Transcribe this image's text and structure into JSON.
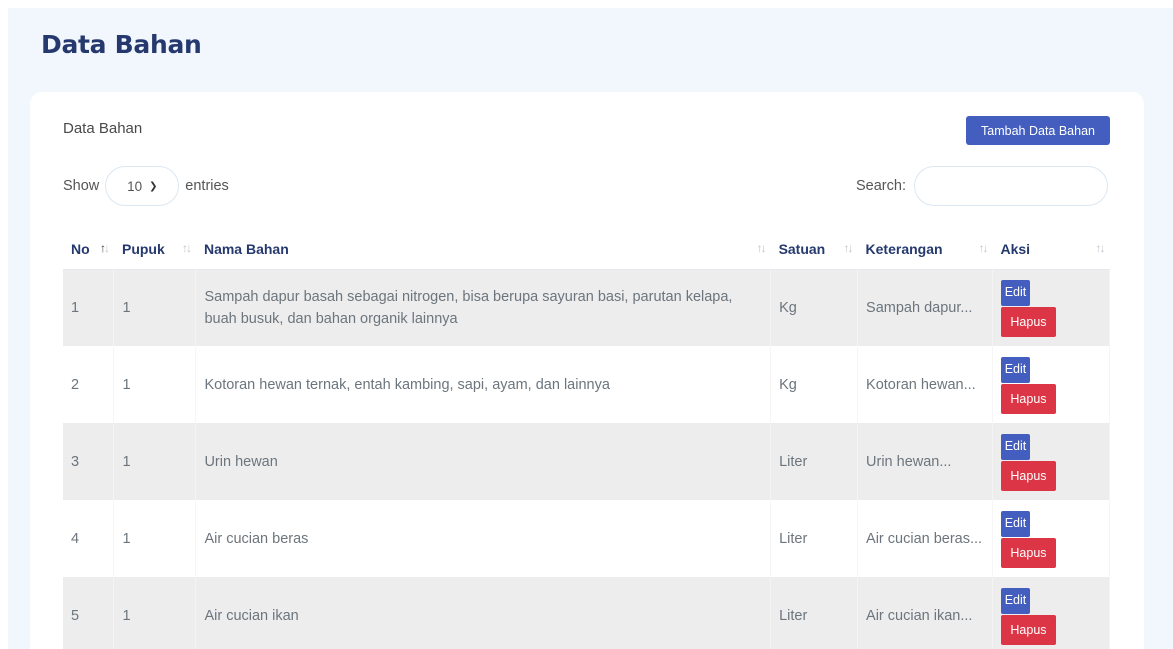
{
  "page": {
    "title": "Data Bahan"
  },
  "card": {
    "title": "Data Bahan",
    "add_button": "Tambah Data Bahan"
  },
  "length": {
    "show": "Show",
    "value": "10",
    "entries": "entries"
  },
  "search": {
    "label": "Search:",
    "value": ""
  },
  "table": {
    "headers": [
      "No",
      "Pupuk",
      "Nama Bahan",
      "Satuan",
      "Keterangan",
      "Aksi"
    ],
    "rows": [
      {
        "no": "1",
        "pupuk": "1",
        "nama": "Sampah dapur basah sebagai nitrogen, bisa berupa sayuran basi, parutan kelapa, buah busuk, dan bahan organik lainnya",
        "satuan": "Kg",
        "keterangan": "Sampah dapur...",
        "edit": "Edit",
        "hapus": "Hapus"
      },
      {
        "no": "2",
        "pupuk": "1",
        "nama": "Kotoran hewan ternak, entah kambing, sapi, ayam, dan lainnya",
        "satuan": "Kg",
        "keterangan": "Kotoran hewan...",
        "edit": "Edit",
        "hapus": "Hapus"
      },
      {
        "no": "3",
        "pupuk": "1",
        "nama": "Urin hewan",
        "satuan": "Liter",
        "keterangan": "Urin hewan...",
        "edit": "Edit",
        "hapus": "Hapus"
      },
      {
        "no": "4",
        "pupuk": "1",
        "nama": "Air cucian beras",
        "satuan": "Liter",
        "keterangan": "Air cucian beras...",
        "edit": "Edit",
        "hapus": "Hapus"
      },
      {
        "no": "5",
        "pupuk": "1",
        "nama": "Air cucian ikan",
        "satuan": "Liter",
        "keterangan": "Air cucian ikan...",
        "edit": "Edit",
        "hapus": "Hapus"
      }
    ]
  },
  "colors": {
    "primary": "#435ebe",
    "danger": "#dc3545",
    "title": "#25396f",
    "background": "#f2f6fd"
  },
  "icons": {
    "sort": "sort-arrows-icon",
    "dropdown": "chevron-down-icon"
  }
}
